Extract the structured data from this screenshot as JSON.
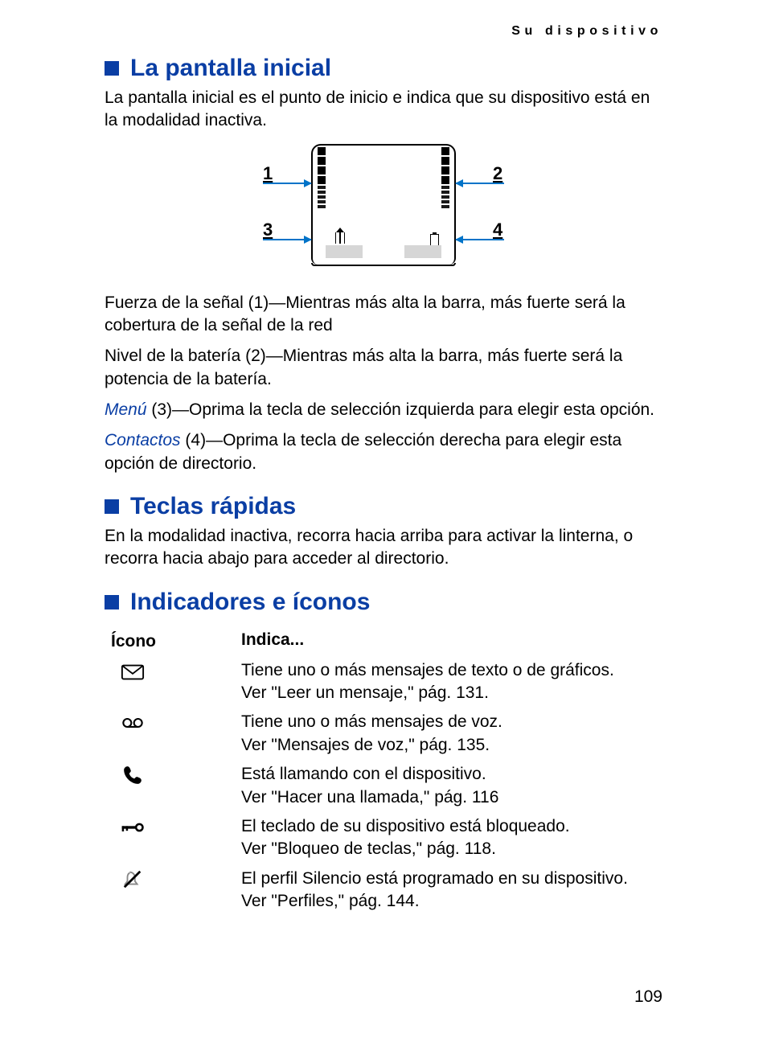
{
  "running_head": "Su  dispositivo",
  "sections": {
    "s1": {
      "title": "La pantalla inicial",
      "intro": "La pantalla inicial es el punto de inicio e indica que su dispositivo está en la modalidad inactiva.",
      "figure_labels": {
        "n1": "1",
        "n2": "2",
        "n3": "3",
        "n4": "4"
      },
      "p1": "Fuerza de la señal (1)—Mientras más alta la barra, más fuerte será la cobertura de la señal de la red",
      "p2": "Nivel de la batería (2)—Mientras más alta la barra, más fuerte será la potencia de la batería.",
      "p3_link": "Menú",
      "p3_rest": " (3)—Oprima la tecla de selección izquierda para elegir esta opción.",
      "p4_link": "Contactos",
      "p4_rest": " (4)—Oprima la tecla de selección derecha para elegir esta opción de directorio."
    },
    "s2": {
      "title": "Teclas rápidas",
      "intro": "En la modalidad inactiva, recorra hacia arriba para activar la linterna, o recorra hacia abajo para acceder al directorio."
    },
    "s3": {
      "title": "Indicadores e íconos",
      "header_icon": "Ícono",
      "header_desc": "Indica...",
      "rows": [
        {
          "icon": "envelope-icon",
          "l1": "Tiene uno o más mensajes de texto o de gráficos.",
          "l2": "Ver \"Leer un mensaje,\" pág. 131."
        },
        {
          "icon": "voicemail-icon",
          "l1": "Tiene uno o más mensajes de voz.",
          "l2": "Ver \"Mensajes de voz,\" pág. 135."
        },
        {
          "icon": "phone-icon",
          "l1": "Está llamando con el dispositivo.",
          "l2": "Ver \"Hacer una llamada,\" pág. 116"
        },
        {
          "icon": "lock-icon",
          "l1": "El teclado de su dispositivo está bloqueado.",
          "l2": "Ver \"Bloqueo de teclas,\" pág. 118."
        },
        {
          "icon": "silent-icon",
          "l1": "El perfil Silencio está programado en su dispositivo.",
          "l2": "Ver \"Perfiles,\" pág. 144."
        }
      ]
    }
  },
  "page_number": "109"
}
